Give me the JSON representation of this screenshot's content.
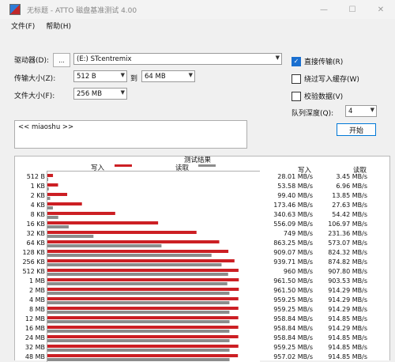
{
  "window": {
    "title": "无标题 - ATTO 磁盘基准测试 4.00",
    "min": "—",
    "max": "☐",
    "close": "✕"
  },
  "menu": {
    "file": "文件(F)",
    "help": "帮助(H)"
  },
  "form": {
    "drive_label": "驱动器(D):",
    "browse_btn": "...",
    "drive_value": "(E:) STcentremix",
    "transfer_label": "传输大小(Z):",
    "transfer_from": "512 B",
    "to_label": "到",
    "transfer_to": "64 MB",
    "file_label": "文件大小(F):",
    "file_value": "256 MB"
  },
  "options": {
    "direct_io": "直接传输(R)",
    "direct_io_checked": true,
    "bypass_cache": "绕过写入缓存(W)",
    "bypass_cache_checked": false,
    "verify": "校验数据(V)",
    "verify_checked": false,
    "queue_label": "队列深度(Q):",
    "queue_value": "4"
  },
  "notes": "<< miaoshu >>",
  "start_button": "开始",
  "results": {
    "title": "测试结果",
    "legend_write": "写入",
    "legend_read": "读取",
    "col_write": "写入",
    "col_read": "读取",
    "write_color": "#cc1f24",
    "read_color": "#8c8c8c"
  },
  "chart_data": {
    "type": "bar",
    "title": "测试结果",
    "categories": [
      "512 B",
      "1 KB",
      "2 KB",
      "4 KB",
      "8 KB",
      "16 KB",
      "32 KB",
      "64 KB",
      "128 KB",
      "256 KB",
      "512 KB",
      "1 MB",
      "2 MB",
      "4 MB",
      "8 MB",
      "12 MB",
      "16 MB",
      "24 MB",
      "32 MB",
      "48 MB"
    ],
    "xlim": [
      0,
      1000
    ],
    "series": [
      {
        "name": "写入",
        "values": [
          28.01,
          53.58,
          99.4,
          173.46,
          340.63,
          556.09,
          749,
          863.25,
          909.07,
          939.71,
          960,
          961.5,
          961.5,
          959.25,
          959.25,
          958.84,
          958.84,
          958.84,
          959.25,
          957.02
        ]
      },
      {
        "name": "读取",
        "values": [
          3.45,
          6.96,
          13.85,
          27.63,
          54.42,
          106.97,
          231.36,
          573.07,
          824.32,
          874.82,
          907.8,
          903.53,
          914.29,
          914.29,
          914.29,
          914.85,
          914.29,
          914.85,
          914.85,
          914.85
        ]
      }
    ],
    "labels_write": [
      "28.01 MB/s",
      "53.58 MB/s",
      "99.40 MB/s",
      "173.46 MB/s",
      "340.63 MB/s",
      "556.09 MB/s",
      "749 MB/s",
      "863.25 MB/s",
      "909.07 MB/s",
      "939.71 MB/s",
      "960 MB/s",
      "961.50 MB/s",
      "961.50 MB/s",
      "959.25 MB/s",
      "959.25 MB/s",
      "958.84 MB/s",
      "958.84 MB/s",
      "958.84 MB/s",
      "959.25 MB/s",
      "957.02 MB/s"
    ],
    "labels_read": [
      "3.45 MB/s",
      "6.96 MB/s",
      "13.85 MB/s",
      "27.63 MB/s",
      "54.42 MB/s",
      "106.97 MB/s",
      "231.36 MB/s",
      "573.07 MB/s",
      "824.32 MB/s",
      "874.82 MB/s",
      "907.80 MB/s",
      "903.53 MB/s",
      "914.29 MB/s",
      "914.29 MB/s",
      "914.29 MB/s",
      "914.85 MB/s",
      "914.29 MB/s",
      "914.85 MB/s",
      "914.85 MB/s",
      "914.85 MB/s"
    ]
  }
}
